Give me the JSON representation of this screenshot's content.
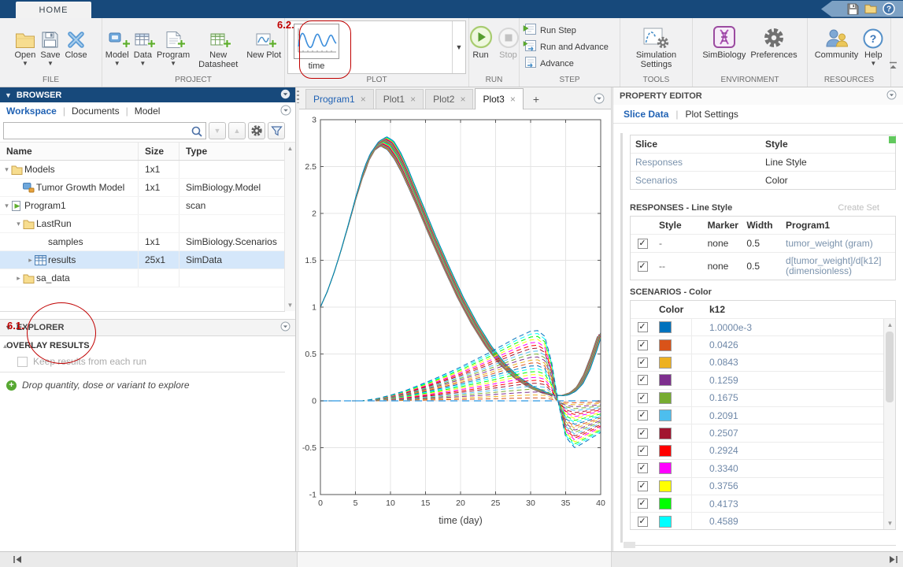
{
  "window": {
    "home_tab": "HOME"
  },
  "colors": {
    "titlebar": "#17497B",
    "ribbon_bg": "#F1F1F2",
    "link_blue": "#2062B4",
    "selection": "#D5E7FA",
    "annotation_red": "#C00000",
    "value_text": "#7A92AC"
  },
  "ribbon": {
    "groups": {
      "file": {
        "label": "FILE",
        "items": [
          {
            "label": "Open"
          },
          {
            "label": "Save"
          },
          {
            "label": "Close"
          }
        ]
      },
      "project": {
        "label": "PROJECT",
        "items": [
          {
            "label": "Model"
          },
          {
            "label": "Data"
          },
          {
            "label": "Program"
          },
          {
            "label": "New Datasheet"
          },
          {
            "label": "New Plot"
          }
        ]
      },
      "plot": {
        "label": "PLOT",
        "gallery_item": "time"
      },
      "run": {
        "label": "RUN",
        "items": [
          {
            "label": "Run"
          },
          {
            "label": "Stop"
          }
        ]
      },
      "step": {
        "label": "STEP",
        "items": [
          "Run Step",
          "Run and Advance",
          "Advance"
        ]
      },
      "tools": {
        "label": "TOOLS",
        "items": [
          "Simulation Settings"
        ]
      },
      "environment": {
        "label": "ENVIRONMENT",
        "items": [
          "SimBiology",
          "Preferences"
        ]
      },
      "resources": {
        "label": "RESOURCES",
        "items": [
          {
            "label": "Community"
          },
          {
            "label": "Help"
          }
        ]
      }
    }
  },
  "browser": {
    "title": "BROWSER",
    "tabs": [
      "Workspace",
      "Documents",
      "Model"
    ],
    "active_tab": "Workspace",
    "search_value": "",
    "columns": [
      "Name",
      "Size",
      "Type"
    ],
    "rows": [
      {
        "name": "Models",
        "size": "1x1",
        "type": "",
        "icon": "folder",
        "indent": 0,
        "expander": "open"
      },
      {
        "name": "Tumor Growth Model",
        "size": "1x1",
        "type": "SimBiology.Model",
        "icon": "model",
        "indent": 1,
        "expander": "none"
      },
      {
        "name": "Program1",
        "size": "",
        "type": "scan",
        "icon": "program",
        "indent": 0,
        "expander": "open"
      },
      {
        "name": "LastRun",
        "size": "",
        "type": "",
        "icon": "folder",
        "indent": 1,
        "expander": "open"
      },
      {
        "name": "samples",
        "size": "1x1",
        "type": "SimBiology.Scenarios",
        "icon": "none",
        "indent": 2,
        "expander": "none"
      },
      {
        "name": "results",
        "size": "25x1",
        "type": "SimData",
        "icon": "table",
        "indent": 2,
        "expander": "closed",
        "selected": true
      },
      {
        "name": "sa_data",
        "size": "",
        "type": "",
        "icon": "folder",
        "indent": 1,
        "expander": "closed"
      }
    ]
  },
  "explorer": {
    "title": "EXPLORER",
    "overlay_heading": "OVERLAY RESULTS",
    "checkbox_label": "Keep results from each run",
    "checkbox_checked": false,
    "drop_hint": "Drop quantity, dose or variant to explore"
  },
  "document_tabs": [
    {
      "label": "Program1",
      "blue": true
    },
    {
      "label": "Plot1"
    },
    {
      "label": "Plot2"
    },
    {
      "label": "Plot3",
      "active": true
    }
  ],
  "new_tab_label": "+",
  "property_editor": {
    "title": "PROPERTY EDITOR",
    "tabs": [
      "Slice Data",
      "Plot Settings"
    ],
    "active_tab": "Slice Data",
    "slice_table": {
      "columns": [
        "Slice",
        "Style"
      ],
      "rows": [
        [
          "Responses",
          "Line Style"
        ],
        [
          "Scenarios",
          "Color"
        ]
      ]
    },
    "responses": {
      "heading": "RESPONSES - Line Style",
      "action": "Create Set",
      "columns": [
        "Style",
        "Marker",
        "Width",
        "Program1"
      ],
      "rows": [
        {
          "checked": true,
          "style": "-",
          "marker": "none",
          "width": "0.5",
          "response": "tumor_weight (gram)"
        },
        {
          "checked": true,
          "style": "--",
          "marker": "none",
          "width": "0.5",
          "response": "d[tumor_weight]/d[k12] (dimensionless)"
        }
      ]
    },
    "scenarios": {
      "heading": "SCENARIOS - Color",
      "columns": [
        "Color",
        "k12"
      ],
      "rows": [
        {
          "checked": true,
          "color": "#0072BD",
          "value": "1.0000e-3"
        },
        {
          "checked": true,
          "color": "#D95319",
          "value": "0.0426"
        },
        {
          "checked": true,
          "color": "#EDB120",
          "value": "0.0843"
        },
        {
          "checked": true,
          "color": "#7E2F8E",
          "value": "0.1259"
        },
        {
          "checked": true,
          "color": "#77AC30",
          "value": "0.1675"
        },
        {
          "checked": true,
          "color": "#4DBEEE",
          "value": "0.2091"
        },
        {
          "checked": true,
          "color": "#A2142F",
          "value": "0.2507"
        },
        {
          "checked": true,
          "color": "#FF0000",
          "value": "0.2924"
        },
        {
          "checked": true,
          "color": "#FF00FF",
          "value": "0.3340"
        },
        {
          "checked": true,
          "color": "#FFFF00",
          "value": "0.3756"
        },
        {
          "checked": true,
          "color": "#00FF00",
          "value": "0.4173"
        },
        {
          "checked": true,
          "color": "#00FFFF",
          "value": "0.4589"
        }
      ]
    }
  },
  "annotations": {
    "step1": "6.1.",
    "step2": "6.2.",
    "color": "#C00000"
  },
  "chart_data": {
    "type": "line",
    "title": "",
    "xlabel": "time (day)",
    "ylabel": "",
    "xlim": [
      0,
      40
    ],
    "ylim": [
      -1,
      3
    ],
    "xticks": [
      0,
      5,
      10,
      15,
      20,
      25,
      30,
      35,
      40
    ],
    "yticks": [
      -1,
      -0.5,
      0,
      0.5,
      1,
      1.5,
      2,
      2.5,
      3
    ],
    "grid": true,
    "n_scenarios": 25,
    "palette": [
      "#0072BD",
      "#D95319",
      "#EDB120",
      "#7E2F8E",
      "#77AC30",
      "#4DBEEE",
      "#A2142F",
      "#FF0000",
      "#FF00FF",
      "#FFFF00",
      "#00FF00",
      "#00FFFF"
    ],
    "responses": [
      "tumor_weight (gram), solid lines",
      "d[tumor_weight]/d[k12] (dimensionless), dashed lines"
    ],
    "tumor_weight_base": {
      "t": [
        0,
        1,
        2,
        3,
        4,
        5,
        6,
        7,
        8,
        9,
        10,
        11,
        12,
        14,
        16,
        18,
        20,
        22,
        24,
        26,
        28,
        30,
        32,
        33,
        34,
        35,
        36,
        37,
        38,
        39,
        40
      ],
      "y": [
        1.0,
        1.17,
        1.38,
        1.62,
        1.88,
        2.15,
        2.4,
        2.6,
        2.72,
        2.77,
        2.73,
        2.62,
        2.47,
        2.12,
        1.76,
        1.42,
        1.1,
        0.82,
        0.58,
        0.39,
        0.25,
        0.15,
        0.085,
        0.065,
        0.055,
        0.06,
        0.09,
        0.16,
        0.3,
        0.5,
        0.73
      ],
      "spread_time_shift_days": 0.45,
      "spread_peak_offset": 0.05
    },
    "sensitivity_shape": {
      "t": [
        0,
        6,
        8,
        10,
        12,
        14,
        16,
        18,
        20,
        22,
        24,
        26,
        28,
        30,
        31,
        32,
        33,
        33.9,
        35,
        36.3,
        37.5,
        40
      ],
      "h": [
        0,
        0,
        0.03,
        0.08,
        0.14,
        0.22,
        0.3,
        0.39,
        0.48,
        0.58,
        0.68,
        0.79,
        0.9,
        0.99,
        1.0,
        0.92,
        0.55,
        0,
        -0.51,
        -0.67,
        -0.6,
        -0.45
      ],
      "max_amplitude": 0.75,
      "note": "amplitude scales ~linearly with scenario index; k12=1e-3 scenario stays flat at 0"
    }
  }
}
